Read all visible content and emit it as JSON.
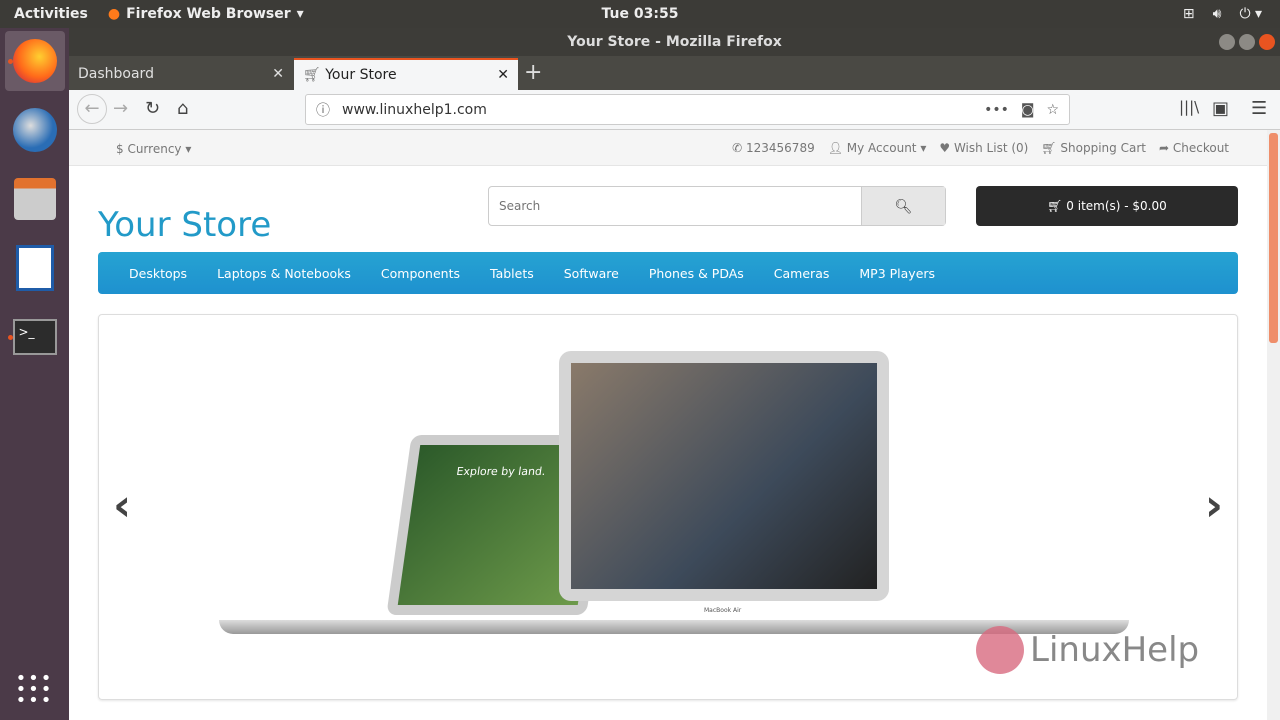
{
  "system": {
    "activities": "Activities",
    "app_menu": "Firefox Web Browser",
    "clock": "Tue 03:55"
  },
  "window": {
    "title": "Your Store - Mozilla Firefox"
  },
  "tabs": [
    {
      "label": "Dashboard",
      "active": false
    },
    {
      "label": "Your Store",
      "active": true
    }
  ],
  "address": {
    "url": "www.linuxhelp1.com"
  },
  "store": {
    "currency": "$ Currency",
    "phone": "123456789",
    "my_account": "My Account",
    "wish_list": "Wish List (0)",
    "shopping_cart": "Shopping Cart",
    "checkout": "Checkout",
    "logo": "Your Store",
    "search_placeholder": "Search",
    "cart_button": "0 item(s) - $0.00",
    "menu": [
      "Desktops",
      "Laptops & Notebooks",
      "Components",
      "Tablets",
      "Software",
      "Phones & PDAs",
      "Cameras",
      "MP3 Players"
    ],
    "accent": "#229ac8"
  },
  "slide": {
    "screen_text": "Explore by land.",
    "laptop_label": "MacBook Air"
  },
  "watermark": "LinuxHelp"
}
